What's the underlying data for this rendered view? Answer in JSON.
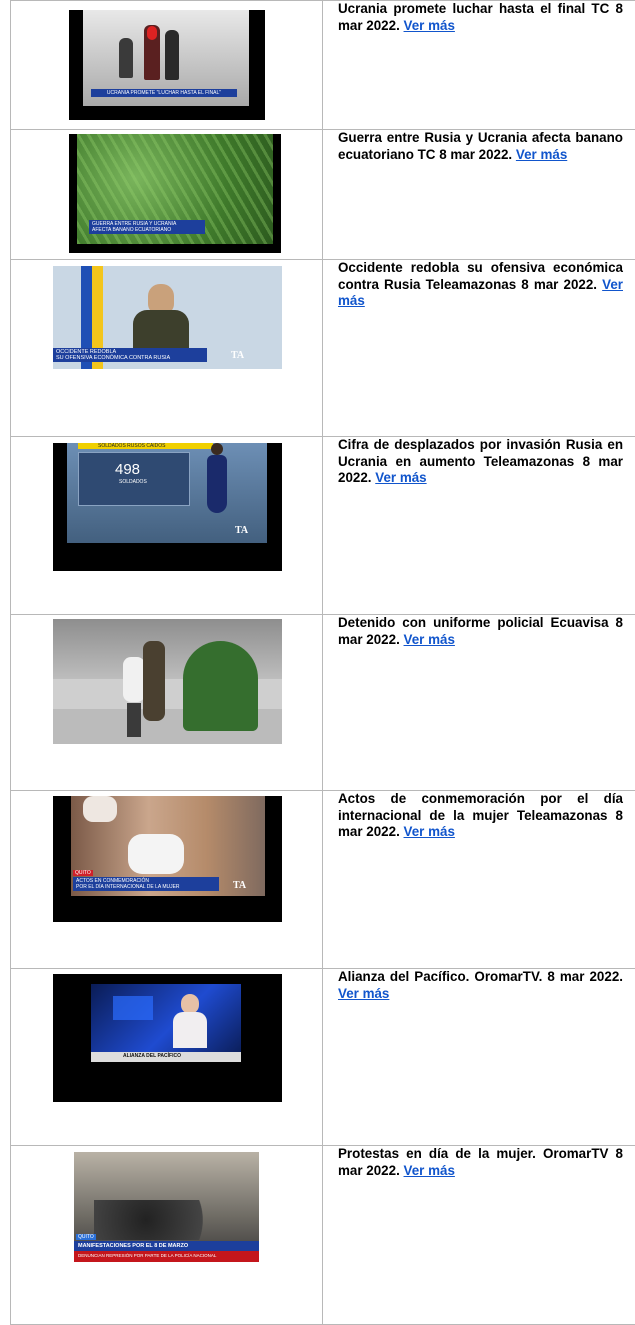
{
  "items": [
    {
      "headline": "Ucrania promete luchar hasta el final TC 8 mar 2022.",
      "link": "Ver más",
      "thumb": {
        "overlay": [
          "UCRANIA PROMETE \"LUCHAR HASTA EL FINAL\""
        ],
        "icon": "news-video-thumbnail"
      }
    },
    {
      "headline": "Guerra entre Rusia y Ucrania afecta banano ecuatoriano TC 8 mar 2022.",
      "link": "Ver más",
      "thumb": {
        "overlay": [
          "GUERRA ENTRE RUSIA Y UCRANIA",
          "AFECTA BANANO ECUATORIANO"
        ],
        "icon": "news-video-thumbnail"
      }
    },
    {
      "headline": "Occidente redobla su ofensiva económica contra Rusia Teleamazonas 8 mar 2022.",
      "link": "Ver más",
      "thumb": {
        "overlay": [
          "OCCIDENTE REDOBLA",
          "SU OFENSIVA ECONÓMICA CONTRA RUSIA"
        ],
        "logo": "TA",
        "icon": "news-video-thumbnail"
      }
    },
    {
      "headline": "Cifra de desplazados por invasión Rusia en Ucrania en aumento Teleamazonas 8 mar 2022.",
      "link": "Ver más",
      "thumb": {
        "screen_title": "SOLDADOS RUSOS CAÍDOS",
        "big_number": "498",
        "small_label": "SOLDADOS",
        "logo": "TA",
        "icon": "news-video-thumbnail"
      }
    },
    {
      "headline": "Detenido con uniforme policial Ecuavisa 8 mar 2022.",
      "link": "Ver más",
      "thumb": {
        "icon": "news-video-thumbnail"
      }
    },
    {
      "headline": "Actos de conmemoración por el día internacional de la mujer Teleamazonas 8 mar 2022.",
      "link": "Ver más",
      "thumb": {
        "tag": "QUITO",
        "overlay": [
          "ACTOS EN CONMEMORACIÓN",
          "POR EL DÍA INTERNACIONAL DE LA MUJER"
        ],
        "logo": "TA",
        "icon": "news-video-thumbnail"
      }
    },
    {
      "headline": "Alianza del Pacífico. OromarTV. 8 mar 2022.",
      "link": "Ver más",
      "thumb": {
        "overlay": [
          "ALIANZA DEL PACÍFICO"
        ],
        "icon": "news-video-thumbnail"
      }
    },
    {
      "headline": "Protestas en día de la mujer. OromarTV 8 mar 2022.",
      "link": "Ver más",
      "thumb": {
        "tag": "QUITO",
        "overlay": [
          "MANIFESTACIONES POR EL 8 DE MARZO",
          "DENUNCIAN REPRESIÓN POR PARTE DE LA POLICÍA NACIONAL"
        ],
        "icon": "news-video-thumbnail"
      }
    }
  ]
}
